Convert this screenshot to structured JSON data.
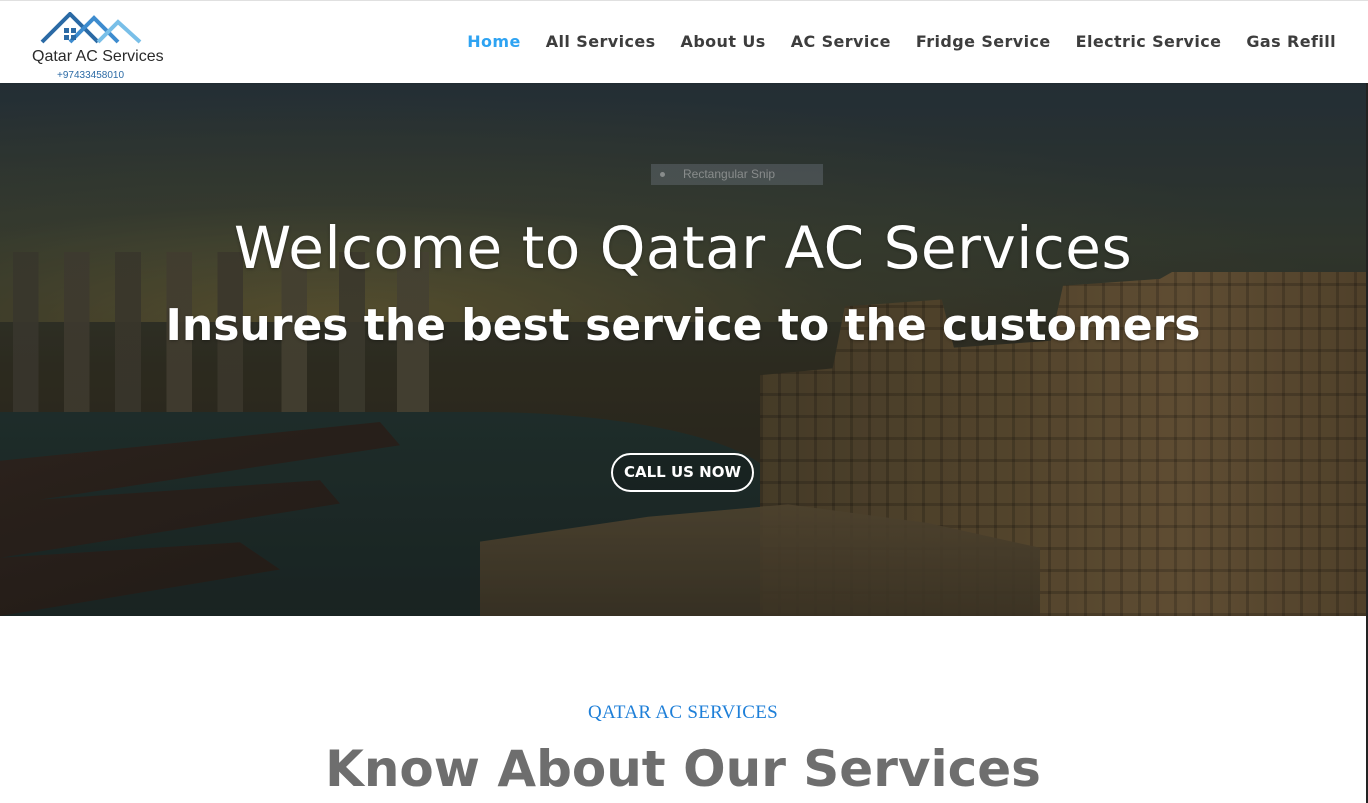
{
  "logo": {
    "name": "Qatar AC Services",
    "phone": "+97433458010"
  },
  "nav": {
    "items": [
      {
        "label": "Home",
        "active": true
      },
      {
        "label": "All Services",
        "active": false
      },
      {
        "label": "About Us",
        "active": false
      },
      {
        "label": "AC Service",
        "active": false
      },
      {
        "label": "Fridge Service",
        "active": false
      },
      {
        "label": "Electric Service",
        "active": false
      },
      {
        "label": "Gas Refill",
        "active": false
      }
    ]
  },
  "snip_overlay": {
    "label": "Rectangular Snip"
  },
  "hero": {
    "title": "Welcome to Qatar AC Services",
    "subtitle": "Insures the best service to the customers",
    "cta_label": "CALL US NOW"
  },
  "section": {
    "kicker": "QATAR AC SERVICES",
    "title": "Know About Our Services"
  },
  "colors": {
    "accent": "#2ea3f2",
    "kicker": "#1e7fd8",
    "section_title": "#6e6e6e",
    "nav_text": "#3d3d3d"
  }
}
